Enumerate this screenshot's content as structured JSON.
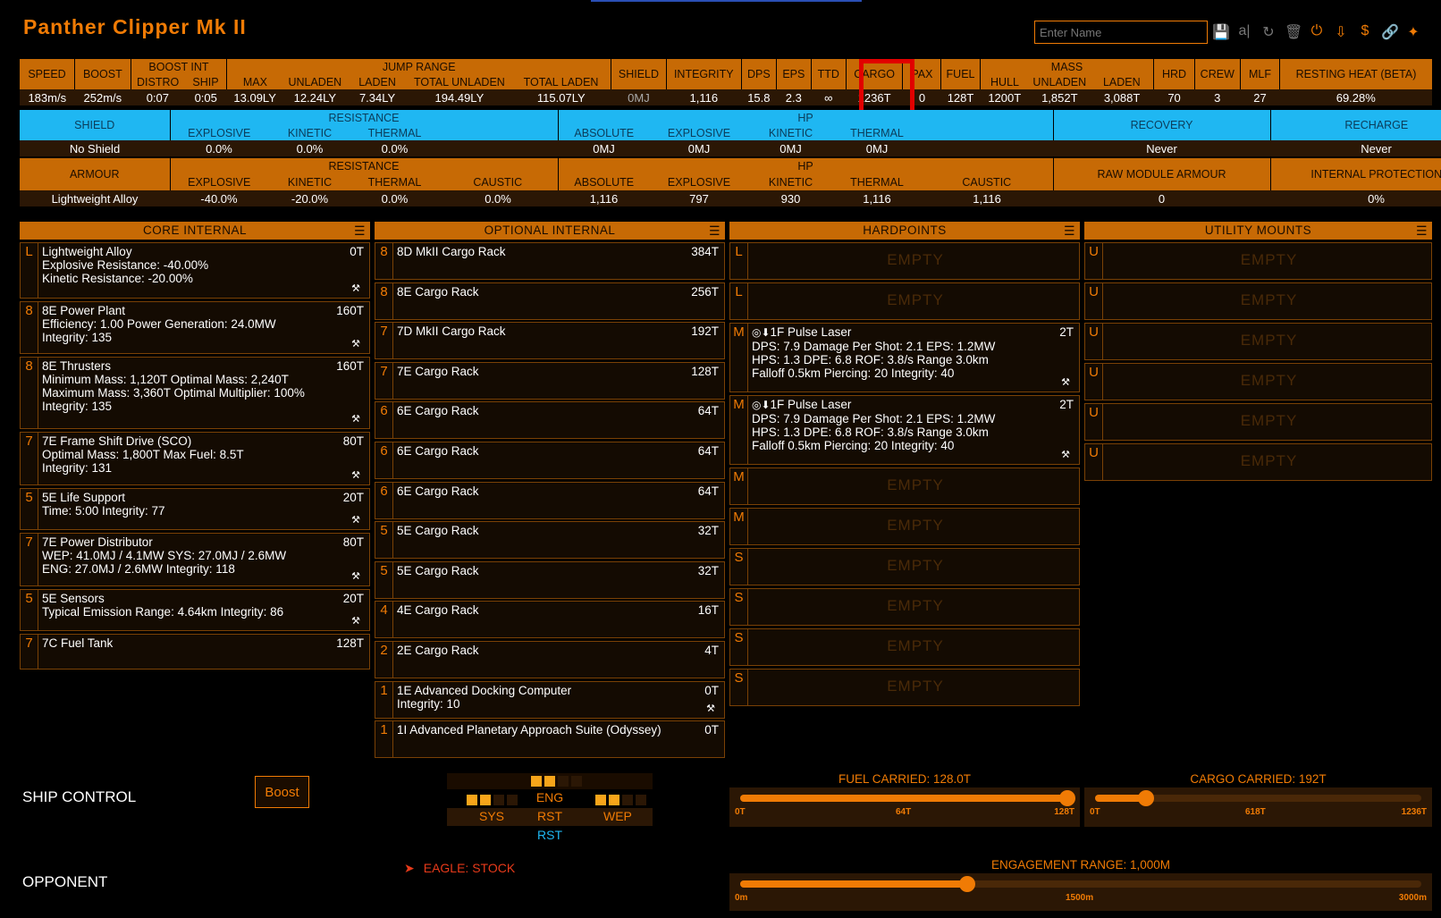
{
  "header": {
    "title": "Panther Clipper Mk II",
    "name_placeholder": "Enter Name"
  },
  "toolbar": {
    "icons": [
      "save-icon",
      "rename-icon",
      "reload-icon",
      "delete-icon",
      "power-icon",
      "export-icon",
      "cost-icon",
      "link-icon",
      "settings-icon"
    ],
    "rename_label": "a|",
    "cost_label": "$"
  },
  "stats": {
    "group_labels": {
      "boost_int": "BOOST INT",
      "jump_range": "JUMP RANGE",
      "mass": "MASS"
    },
    "headers": [
      "SPEED",
      "BOOST",
      "DISTRO",
      "SHIP",
      "MAX",
      "UNLADEN",
      "LADEN",
      "TOTAL UNLADEN",
      "TOTAL LADEN",
      "SHIELD",
      "INTEGRITY",
      "DPS",
      "EPS",
      "TTD",
      "CARGO",
      "PAX",
      "FUEL",
      "HULL",
      "UNLADEN",
      "LADEN",
      "HRD",
      "CREW",
      "MLF",
      "RESTING HEAT (BETA)"
    ],
    "values": [
      "183m/s",
      "252m/s",
      "0:07",
      "0:05",
      "13.09LY",
      "12.24LY",
      "7.34LY",
      "194.49LY",
      "115.07LY",
      "0MJ",
      "1,116",
      "15.8",
      "2.3",
      "∞",
      "1236T",
      "0",
      "128T",
      "1200T",
      "1,852T",
      "3,088T",
      "70",
      "3",
      "27",
      "69.28%"
    ]
  },
  "shield": {
    "label": "SHIELD",
    "resistance_label": "RESISTANCE",
    "hp_label": "HP",
    "recovery_label": "RECOVERY",
    "recharge_label": "RECHARGE",
    "sub_headers": [
      "EXPLOSIVE",
      "KINETIC",
      "THERMAL",
      "ABSOLUTE",
      "EXPLOSIVE",
      "KINETIC",
      "THERMAL"
    ],
    "values": [
      "No Shield",
      "0.0%",
      "0.0%",
      "0.0%",
      "0MJ",
      "0MJ",
      "0MJ",
      "0MJ",
      "Never",
      "Never"
    ]
  },
  "armour": {
    "label": "ARMOUR",
    "resistance_label": "RESISTANCE",
    "hp_label": "HP",
    "raw_label": "RAW MODULE ARMOUR",
    "internal_label": "INTERNAL PROTECTION",
    "sub_headers": [
      "EXPLOSIVE",
      "KINETIC",
      "THERMAL",
      "CAUSTIC",
      "ABSOLUTE",
      "EXPLOSIVE",
      "KINETIC",
      "THERMAL",
      "CAUSTIC"
    ],
    "values": [
      "Lightweight Alloy",
      "-40.0%",
      "-20.0%",
      "0.0%",
      "0.0%",
      "1,116",
      "797",
      "930",
      "1,116",
      "1,116",
      "0",
      "0%"
    ]
  },
  "core": {
    "title": "CORE INTERNAL",
    "slots": [
      {
        "cls": "L",
        "lines": [
          "Lightweight Alloy",
          "Explosive Resistance: -40.00%",
          "Kinetic Resistance: -20.00%"
        ],
        "mass": "0T"
      },
      {
        "cls": "8",
        "lines": [
          "8E Power Plant",
          "Efficiency: 1.00   Power Generation: 24.0MW",
          "Integrity: 135"
        ],
        "mass": "160T"
      },
      {
        "cls": "8",
        "lines": [
          "8E Thrusters",
          "Minimum Mass: 1,120T   Optimal Mass: 2,240T",
          "Maximum Mass: 3,360T   Optimal Multiplier: 100%",
          "Integrity: 135"
        ],
        "mass": "160T"
      },
      {
        "cls": "7",
        "lines": [
          "7E Frame Shift Drive (SCO)",
          "Optimal Mass: 1,800T   Max Fuel: 8.5T",
          "Integrity: 131"
        ],
        "mass": "80T"
      },
      {
        "cls": "5",
        "lines": [
          "5E Life Support",
          "Time: 5:00   Integrity: 77"
        ],
        "mass": "20T"
      },
      {
        "cls": "7",
        "lines": [
          "7E Power Distributor",
          "WEP: 41.0MJ / 4.1MW   SYS: 27.0MJ / 2.6MW",
          "ENG: 27.0MJ / 2.6MW   Integrity: 118"
        ],
        "mass": "80T"
      },
      {
        "cls": "5",
        "lines": [
          "5E Sensors",
          "Typical Emission Range: 4.64km   Integrity: 86"
        ],
        "mass": "20T"
      },
      {
        "cls": "7",
        "lines": [
          "7C Fuel Tank"
        ],
        "mass": "128T"
      }
    ]
  },
  "optional": {
    "title": "OPTIONAL INTERNAL",
    "slots": [
      {
        "cls": "8",
        "lines": [
          "8D MkII Cargo Rack"
        ],
        "mass": "384T"
      },
      {
        "cls": "8",
        "lines": [
          "8E Cargo Rack"
        ],
        "mass": "256T"
      },
      {
        "cls": "7",
        "lines": [
          "7D MkII Cargo Rack"
        ],
        "mass": "192T"
      },
      {
        "cls": "7",
        "lines": [
          "7E Cargo Rack"
        ],
        "mass": "128T"
      },
      {
        "cls": "6",
        "lines": [
          "6E Cargo Rack"
        ],
        "mass": "64T"
      },
      {
        "cls": "6",
        "lines": [
          "6E Cargo Rack"
        ],
        "mass": "64T"
      },
      {
        "cls": "6",
        "lines": [
          "6E Cargo Rack"
        ],
        "mass": "64T"
      },
      {
        "cls": "5",
        "lines": [
          "5E Cargo Rack"
        ],
        "mass": "32T"
      },
      {
        "cls": "5",
        "lines": [
          "5E Cargo Rack"
        ],
        "mass": "32T"
      },
      {
        "cls": "4",
        "lines": [
          "4E Cargo Rack"
        ],
        "mass": "16T"
      },
      {
        "cls": "2",
        "lines": [
          "2E Cargo Rack"
        ],
        "mass": "4T"
      },
      {
        "cls": "1",
        "lines": [
          "1E Advanced Docking Computer",
          "Integrity: 10"
        ],
        "mass": "0T"
      },
      {
        "cls": "1",
        "lines": [
          "1I Advanced Planetary Approach Suite (Odyssey)"
        ],
        "mass": "0T"
      }
    ]
  },
  "hardpoints": {
    "title": "HARDPOINTS",
    "empty_label": "EMPTY",
    "slots": [
      {
        "cls": "L",
        "lines": [],
        "mass": ""
      },
      {
        "cls": "L",
        "lines": [],
        "mass": ""
      },
      {
        "cls": "M",
        "lines": [
          "1F Pulse Laser",
          "DPS: 7.9   Damage Per Shot: 2.1   EPS: 1.2MW",
          "HPS: 1.3   DPE: 6.8   ROF: 3.8/s   Range 3.0km",
          "Falloff 0.5km   Piercing: 20   Integrity: 40"
        ],
        "mass": "2T"
      },
      {
        "cls": "M",
        "lines": [
          "1F Pulse Laser",
          "DPS: 7.9   Damage Per Shot: 2.1   EPS: 1.2MW",
          "HPS: 1.3   DPE: 6.8   ROF: 3.8/s   Range 3.0km",
          "Falloff 0.5km   Piercing: 20   Integrity: 40"
        ],
        "mass": "2T"
      },
      {
        "cls": "M",
        "lines": [],
        "mass": ""
      },
      {
        "cls": "M",
        "lines": [],
        "mass": ""
      },
      {
        "cls": "S",
        "lines": [],
        "mass": ""
      },
      {
        "cls": "S",
        "lines": [],
        "mass": ""
      },
      {
        "cls": "S",
        "lines": [],
        "mass": ""
      },
      {
        "cls": "S",
        "lines": [],
        "mass": ""
      }
    ]
  },
  "utility": {
    "title": "UTILITY MOUNTS",
    "slots": [
      {
        "cls": "U",
        "lines": [],
        "mass": ""
      },
      {
        "cls": "U",
        "lines": [],
        "mass": ""
      },
      {
        "cls": "U",
        "lines": [],
        "mass": ""
      },
      {
        "cls": "U",
        "lines": [],
        "mass": ""
      },
      {
        "cls": "U",
        "lines": [],
        "mass": ""
      },
      {
        "cls": "U",
        "lines": [],
        "mass": ""
      }
    ]
  },
  "controls": {
    "ship_control": "SHIP CONTROL",
    "boost": "Boost",
    "opponent": "OPPONENT",
    "opponent_ship": "EAGLE: STOCK",
    "pips": {
      "sys": "SYS",
      "eng": "ENG",
      "wep": "WEP",
      "rst": "RST",
      "sys_level": 2,
      "eng_level": 2,
      "wep_level": 2
    },
    "fuel": {
      "title": "FUEL CARRIED: 128.0T",
      "min": "0T",
      "mid": "64T",
      "max": "128T",
      "fraction": 1.0
    },
    "cargo": {
      "title": "CARGO CARRIED: 192T",
      "min": "0T",
      "mid": "618T",
      "max": "1236T",
      "fraction": 0.155
    },
    "range": {
      "title": "ENGAGEMENT RANGE: 1,000M",
      "min": "0m",
      "mid": "1500m",
      "max": "3000m",
      "fraction": 0.333
    }
  }
}
